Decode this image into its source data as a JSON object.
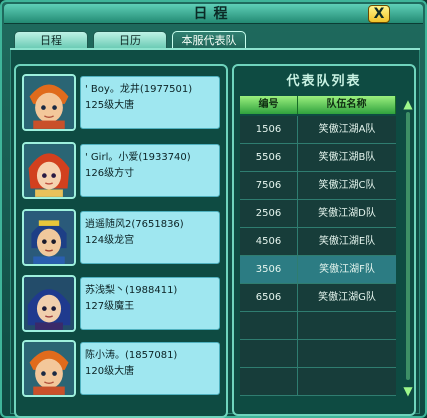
{
  "window": {
    "title": "日程",
    "close_label": "X"
  },
  "tabs": [
    {
      "label": "日程",
      "active": false
    },
    {
      "label": "日历",
      "active": false
    },
    {
      "label": "本服代表队",
      "active": true
    }
  ],
  "members": [
    {
      "name": "' Boy。龙井(1977501)",
      "level": "125级大唐",
      "avatar": "boy-portrait-icon"
    },
    {
      "name": "' Girl。小爱(1933740)",
      "level": "126级方寸",
      "avatar": "girl-portrait-icon"
    },
    {
      "name": "逍遥随风2(7651836)",
      "level": "124级龙宫",
      "avatar": "dragon-palace-portrait-icon"
    },
    {
      "name": "苏浅梨丶(1988411)",
      "level": "127级魔王",
      "avatar": "demon-king-portrait-icon"
    },
    {
      "name": "陈小涛。(1857081)",
      "level": "120级大唐",
      "avatar": "boy-portrait-icon"
    }
  ],
  "team_list": {
    "title": "代表队列表",
    "headers": [
      "编号",
      "队伍名称"
    ],
    "rows": [
      {
        "id": "1506",
        "name": "笑傲江湖A队"
      },
      {
        "id": "5506",
        "name": "笑傲江湖B队"
      },
      {
        "id": "7506",
        "name": "笑傲江湖C队"
      },
      {
        "id": "2506",
        "name": "笑傲江湖D队"
      },
      {
        "id": "4506",
        "name": "笑傲江湖E队"
      },
      {
        "id": "3506",
        "name": "笑傲江湖F队"
      },
      {
        "id": "6506",
        "name": "笑傲江湖G队"
      },
      {
        "id": "",
        "name": ""
      },
      {
        "id": "",
        "name": ""
      },
      {
        "id": "",
        "name": ""
      }
    ],
    "highlighted_row": 5
  },
  "colors": {
    "accent_green": "#9bf07e",
    "panel_bg": "#0e4b42",
    "info_bg": "#9fe7f0"
  }
}
